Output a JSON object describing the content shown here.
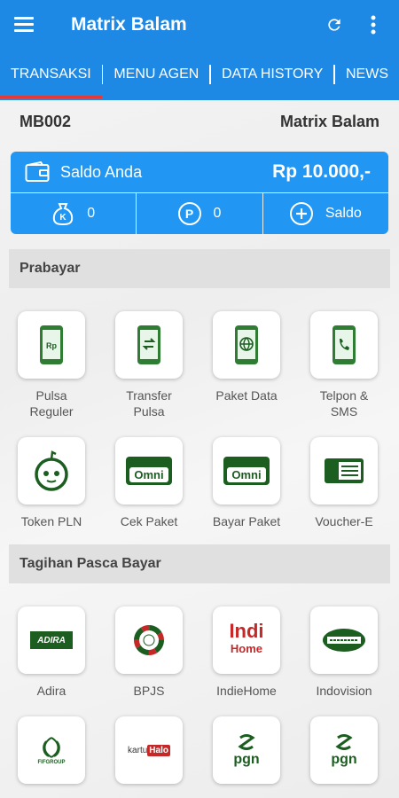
{
  "app": {
    "title": "Matrix Balam"
  },
  "tabs": [
    {
      "label": "TRANSAKSI",
      "active": true
    },
    {
      "label": "MENU AGEN"
    },
    {
      "label": "DATA HISTORY"
    },
    {
      "label": "NEWS"
    }
  ],
  "account": {
    "id": "MB002",
    "name": "Matrix Balam"
  },
  "balance": {
    "label": "Saldo Anda",
    "amount": "Rp 10.000,-",
    "komisi_icon_letter": "K",
    "komisi": "0",
    "poin_icon_letter": "P",
    "poin": "0",
    "topup_label": "Saldo"
  },
  "sections": {
    "prabayar": {
      "title": "Prabayar",
      "items": [
        {
          "label": "Pulsa\nReguler",
          "icon": "phone-rp-icon"
        },
        {
          "label": "Transfer\nPulsa",
          "icon": "phone-transfer-icon"
        },
        {
          "label": "Paket Data",
          "icon": "phone-globe-icon"
        },
        {
          "label": "Telpon &\nSMS",
          "icon": "phone-call-icon"
        },
        {
          "label": "Token PLN",
          "icon": "pln-token-icon"
        },
        {
          "label": "Cek Paket",
          "icon": "omni-logo",
          "logo_text": "Omni"
        },
        {
          "label": "Bayar Paket",
          "icon": "omni-logo",
          "logo_text": "Omni"
        },
        {
          "label": "Voucher-E",
          "icon": "voucher-icon"
        }
      ]
    },
    "pascabayar": {
      "title": "Tagihan Pasca Bayar",
      "items": [
        {
          "label": "Adira",
          "icon": "adira-logo",
          "logo_text": "ADIRA"
        },
        {
          "label": "BPJS",
          "icon": "bpjs-logo"
        },
        {
          "label": "IndieHome",
          "icon": "indihome-logo",
          "logo_text": "Indi",
          "logo_text2": "Home"
        },
        {
          "label": "Indovision",
          "icon": "indovision-logo"
        },
        {
          "label": "",
          "icon": "fif-logo",
          "logo_text": "FIFGROUP"
        },
        {
          "label": "",
          "icon": "kartuhalo-logo",
          "logo_text": "kartu",
          "logo_text2": "Halo"
        },
        {
          "label": "",
          "icon": "pgn-logo",
          "logo_text": "pgn"
        },
        {
          "label": "",
          "icon": "pgn-logo",
          "logo_text": "pgn"
        }
      ]
    }
  },
  "colors": {
    "primary": "#1e88e5",
    "card": "#2196f3",
    "tab_indicator": "#e53935",
    "icon_green": "#1b5e20"
  }
}
